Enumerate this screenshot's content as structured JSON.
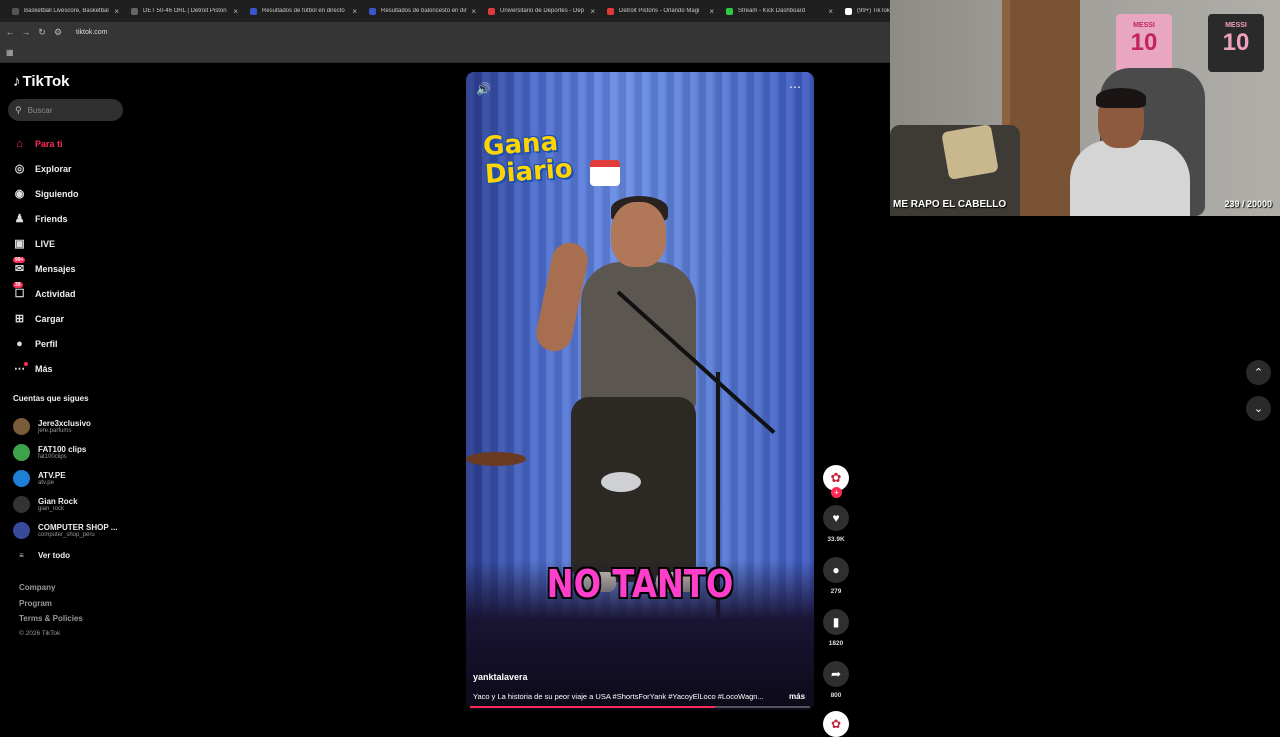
{
  "browser": {
    "tabs": [
      {
        "label": "Basketball Livescore, Basketbal",
        "color": "#2b2b2b",
        "fav": "#555555"
      },
      {
        "label": "DET 50-46 ORL | Detroit Piston",
        "color": "#2b2b2b",
        "fav": "#666666"
      },
      {
        "label": "Resultados de fútbol en directo",
        "color": "#2b2b2b",
        "fav": "#3a54c9"
      },
      {
        "label": "Resultados de baloncesto en dir",
        "color": "#2b2b2b",
        "fav": "#3a54c9"
      },
      {
        "label": "Universitario de Deportes - Dep",
        "color": "#2b2b2b",
        "fav": "#e03a3a"
      },
      {
        "label": "Detroit Pistons - Orlando Magi",
        "color": "#2b2b2b",
        "fav": "#e03a3a"
      },
      {
        "label": "Stream - Kick Dashboard",
        "color": "#2b2b2b",
        "fav": "#2ecc40"
      },
      {
        "label": "(99+) TikTok",
        "color": "#1f1f1f",
        "fav": "#ffffff"
      }
    ],
    "url": "tiktok.com"
  },
  "sidebar": {
    "logo": "TikTok",
    "search_placeholder": "Buscar",
    "nav": [
      {
        "label": "Para ti",
        "icon": "home-icon",
        "glyph": "⌂",
        "active": true
      },
      {
        "label": "Explorar",
        "icon": "compass-icon",
        "glyph": "◎"
      },
      {
        "label": "Siguiendo",
        "icon": "following-icon",
        "glyph": "◉"
      },
      {
        "label": "Friends",
        "icon": "friends-icon",
        "glyph": "♟"
      },
      {
        "label": "LIVE",
        "icon": "live-icon",
        "glyph": "▣"
      },
      {
        "label": "Mensajes",
        "icon": "message-icon",
        "glyph": "✉",
        "badge": "99+"
      },
      {
        "label": "Actividad",
        "icon": "activity-icon",
        "glyph": "☐",
        "badge": "39"
      },
      {
        "label": "Cargar",
        "icon": "upload-icon",
        "glyph": "⊞"
      },
      {
        "label": "Perfil",
        "icon": "profile-icon",
        "glyph": "●"
      },
      {
        "label": "Más",
        "icon": "more-icon",
        "glyph": "⋯",
        "dot": true
      }
    ],
    "following_title": "Cuentas que sigues",
    "following": [
      {
        "name": "Jere3xclusivo",
        "handle": "jere.parfums",
        "color": "#7a5b3a"
      },
      {
        "name": "FAT100 clips",
        "handle": "fat100clips",
        "color": "#3ca34a"
      },
      {
        "name": "ATV.PE",
        "handle": "atv.pe",
        "color": "#1e7fd6"
      },
      {
        "name": "Gian Rock",
        "handle": "gian_rock",
        "color": "#333333"
      },
      {
        "name": "COMPUTER SHOP ...",
        "handle": "computer_shop_peru",
        "color": "#3a4a9a"
      }
    ],
    "see_all": "Ver todo",
    "footer": [
      "Company",
      "Program",
      "Terms & Policies"
    ],
    "copyright": "© 2026 TikTok"
  },
  "video": {
    "overlay_title_1": "Gana",
    "overlay_title_2": "Diario",
    "caption": "NO TANTO",
    "author": "yanktalavera",
    "description": "Yaco y La historia de su peor viaje a USA #ShortsForYank #YacoyElLoco #LocoWagn...",
    "more_label": "más",
    "progress": 0.72
  },
  "actions": {
    "likes": "33.9K",
    "comments": "279",
    "saves": "1820",
    "shares": "800"
  },
  "webcam": {
    "title": "ME RAPO EL CABELLO",
    "count": "239 / 20000",
    "jersey_name": "MESSI",
    "jersey_number": "10"
  }
}
